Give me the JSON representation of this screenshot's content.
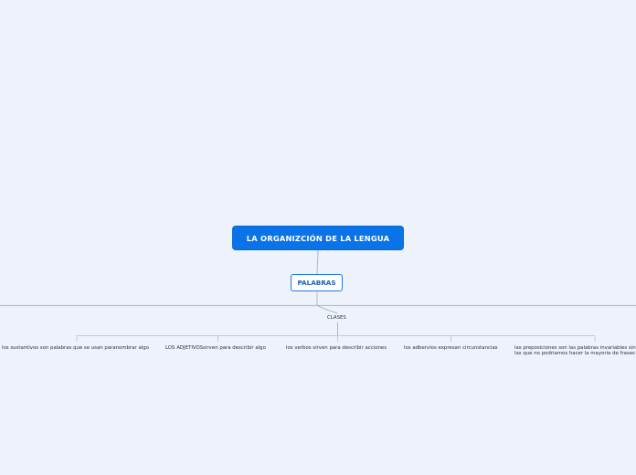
{
  "root": {
    "label": "LA ORGANIZCIÓN DE LA LENGUA"
  },
  "main": {
    "label": "PALABRAS"
  },
  "category": {
    "label": "CLASES"
  },
  "leaves": [
    {
      "label": "los sustantivos son palabras que se usan paranombrar algo"
    },
    {
      "label": "LOS ADJETIVOSsirven para describir algo"
    },
    {
      "label": "los verbos sirven para describir acciones"
    },
    {
      "label": "los adbervios expresan circunstancias"
    },
    {
      "label": "las preposiciones son las palabras invariables sin las que no podriamos hacer la mayoria de frases"
    }
  ],
  "colors": {
    "background": "#eef3fb",
    "root_fill": "#0b73e8",
    "main_border": "#1e7ae6",
    "connector": "#a9b7c6"
  }
}
